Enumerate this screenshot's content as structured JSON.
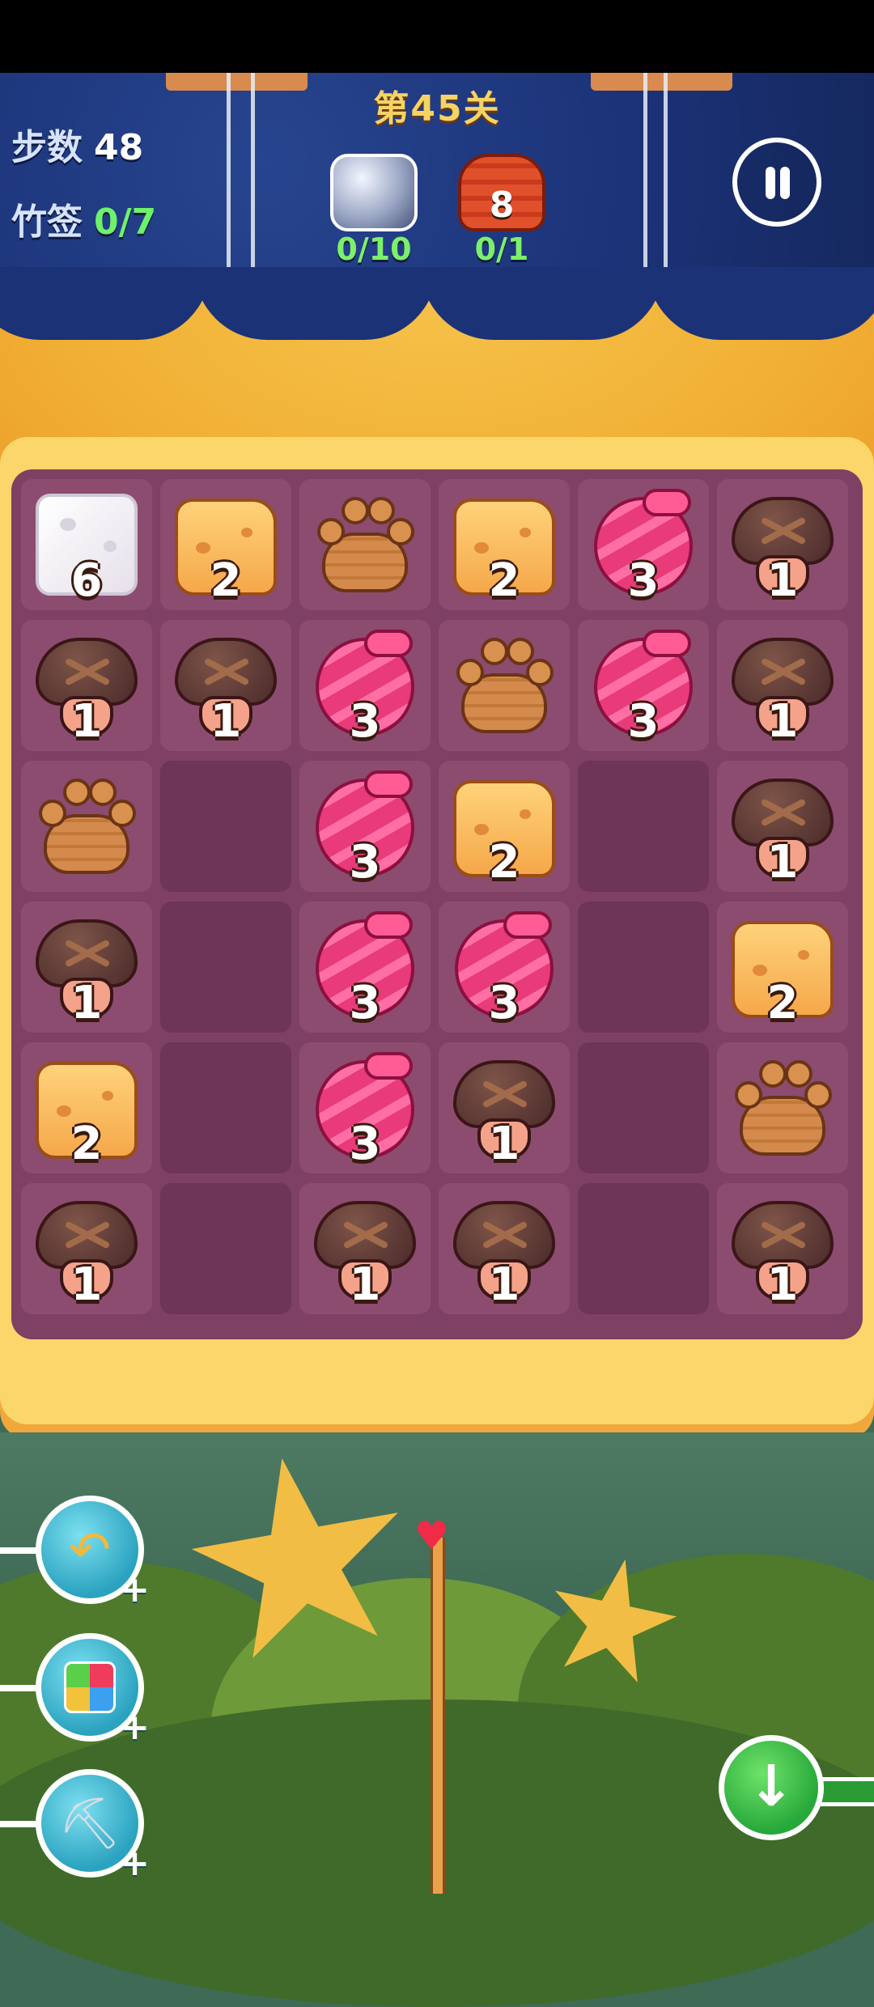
{
  "header": {
    "level_title": "第45关",
    "moves_label": "步数",
    "moves_value": "48",
    "skewers_label": "竹签",
    "skewers_value": "0/7",
    "targets": [
      {
        "icon": "ice-ball-icon",
        "count": "0/10",
        "badge": ""
      },
      {
        "icon": "red-cake-icon",
        "count": "0/1",
        "badge": "8"
      }
    ]
  },
  "board": {
    "rows": [
      [
        {
          "type": "ice",
          "num": "6"
        },
        {
          "type": "cheese",
          "num": "2"
        },
        {
          "type": "paw",
          "num": ""
        },
        {
          "type": "cheese",
          "num": "2"
        },
        {
          "type": "candy",
          "num": "3"
        },
        {
          "type": "mushroom",
          "num": "1"
        }
      ],
      [
        {
          "type": "mushroom",
          "num": "1"
        },
        {
          "type": "mushroom",
          "num": "1"
        },
        {
          "type": "candy",
          "num": "3"
        },
        {
          "type": "paw",
          "num": ""
        },
        {
          "type": "candy",
          "num": "3"
        },
        {
          "type": "mushroom",
          "num": "1"
        }
      ],
      [
        {
          "type": "paw",
          "num": ""
        },
        {
          "type": "empty",
          "num": ""
        },
        {
          "type": "candy",
          "num": "3"
        },
        {
          "type": "cheese",
          "num": "2"
        },
        {
          "type": "empty",
          "num": ""
        },
        {
          "type": "mushroom",
          "num": "1"
        }
      ],
      [
        {
          "type": "mushroom",
          "num": "1"
        },
        {
          "type": "empty",
          "num": ""
        },
        {
          "type": "candy",
          "num": "3"
        },
        {
          "type": "candy",
          "num": "3"
        },
        {
          "type": "empty",
          "num": ""
        },
        {
          "type": "cheese",
          "num": "2"
        }
      ],
      [
        {
          "type": "cheese",
          "num": "2"
        },
        {
          "type": "empty",
          "num": ""
        },
        {
          "type": "candy",
          "num": "3"
        },
        {
          "type": "mushroom",
          "num": "1"
        },
        {
          "type": "empty",
          "num": ""
        },
        {
          "type": "paw",
          "num": ""
        }
      ],
      [
        {
          "type": "mushroom",
          "num": "1"
        },
        {
          "type": "empty",
          "num": ""
        },
        {
          "type": "mushroom",
          "num": "1"
        },
        {
          "type": "mushroom",
          "num": "1"
        },
        {
          "type": "empty",
          "num": ""
        },
        {
          "type": "mushroom",
          "num": "1"
        }
      ]
    ]
  },
  "boosters": [
    {
      "name": "undo-booster",
      "icon": "undo-arrow-icon",
      "plus": "+"
    },
    {
      "name": "cube-booster",
      "icon": "rubik-cube-icon",
      "plus": "+"
    },
    {
      "name": "shovel-booster",
      "icon": "shovel-icon",
      "plus": "+"
    }
  ],
  "colors": {
    "header_bg": "#1b3277",
    "board_bg": "#7e4063",
    "frame": "#fbd66a",
    "accent_green": "#6ef26a"
  }
}
